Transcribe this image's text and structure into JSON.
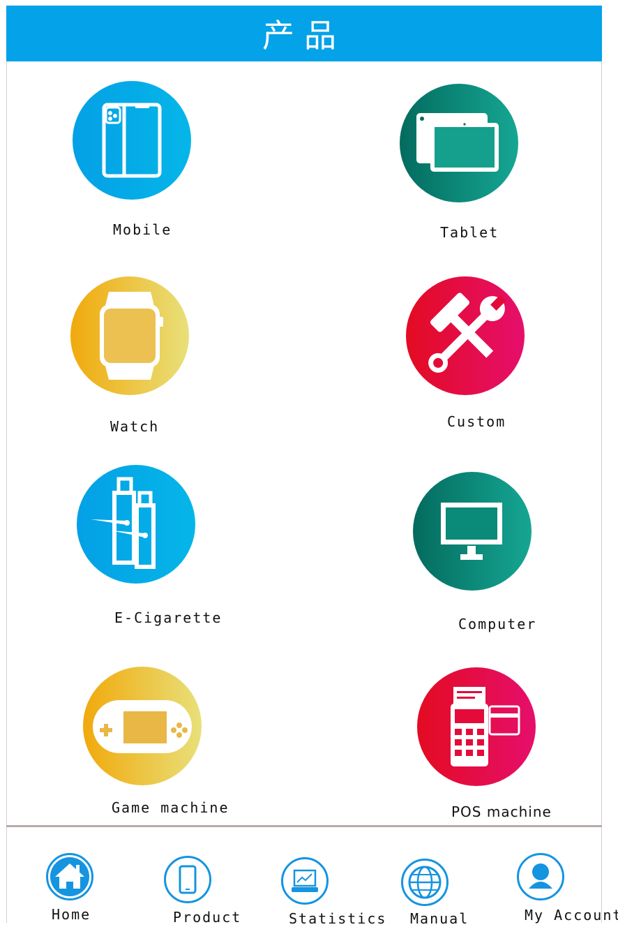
{
  "header": {
    "title": "产品"
  },
  "products": [
    {
      "label": "Mobile",
      "icon": "phone-icon"
    },
    {
      "label": "Tablet",
      "icon": "tablet-icon"
    },
    {
      "label": "Watch",
      "icon": "watch-icon"
    },
    {
      "label": "Custom",
      "icon": "tools-icon"
    },
    {
      "label": "E-Cigarette",
      "icon": "e-cigarette-icon"
    },
    {
      "label": "Computer",
      "icon": "monitor-icon"
    },
    {
      "label": "Game machine",
      "icon": "gamepad-icon"
    },
    {
      "label": "POS machine",
      "icon": "pos-terminal-icon"
    }
  ],
  "bottom_nav": [
    {
      "label": "Home",
      "icon": "home-icon"
    },
    {
      "label": "Product",
      "icon": "phone-icon"
    },
    {
      "label": "Statistics",
      "icon": "laptop-chart-icon"
    },
    {
      "label": "Manual",
      "icon": "globe-icon"
    },
    {
      "label": "My Account",
      "icon": "user-icon"
    }
  ],
  "colors": {
    "header": "#04a2e8",
    "nav_accent": "#1594e0",
    "blue": "#04a0e6",
    "green": "#036b5e",
    "yellow": "#f1a90c",
    "red": "#e40b22"
  }
}
